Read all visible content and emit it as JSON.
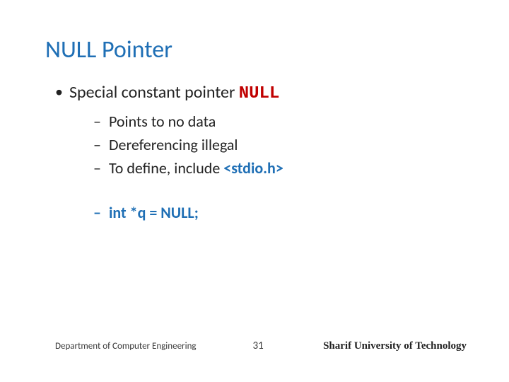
{
  "title": "NULL Pointer",
  "bullet1_prefix": "Special constant pointer ",
  "bullet1_null": "NULL",
  "sub1": "Points to no data",
  "sub2": "Dereferencing illegal",
  "sub3_prefix": "To define, include ",
  "sub3_stdio": "<stdio.h>",
  "sub4": "int  *q = NULL;",
  "footer_left": "Department of Computer Engineering",
  "footer_page": "31",
  "footer_right": "Sharif University of Technology"
}
